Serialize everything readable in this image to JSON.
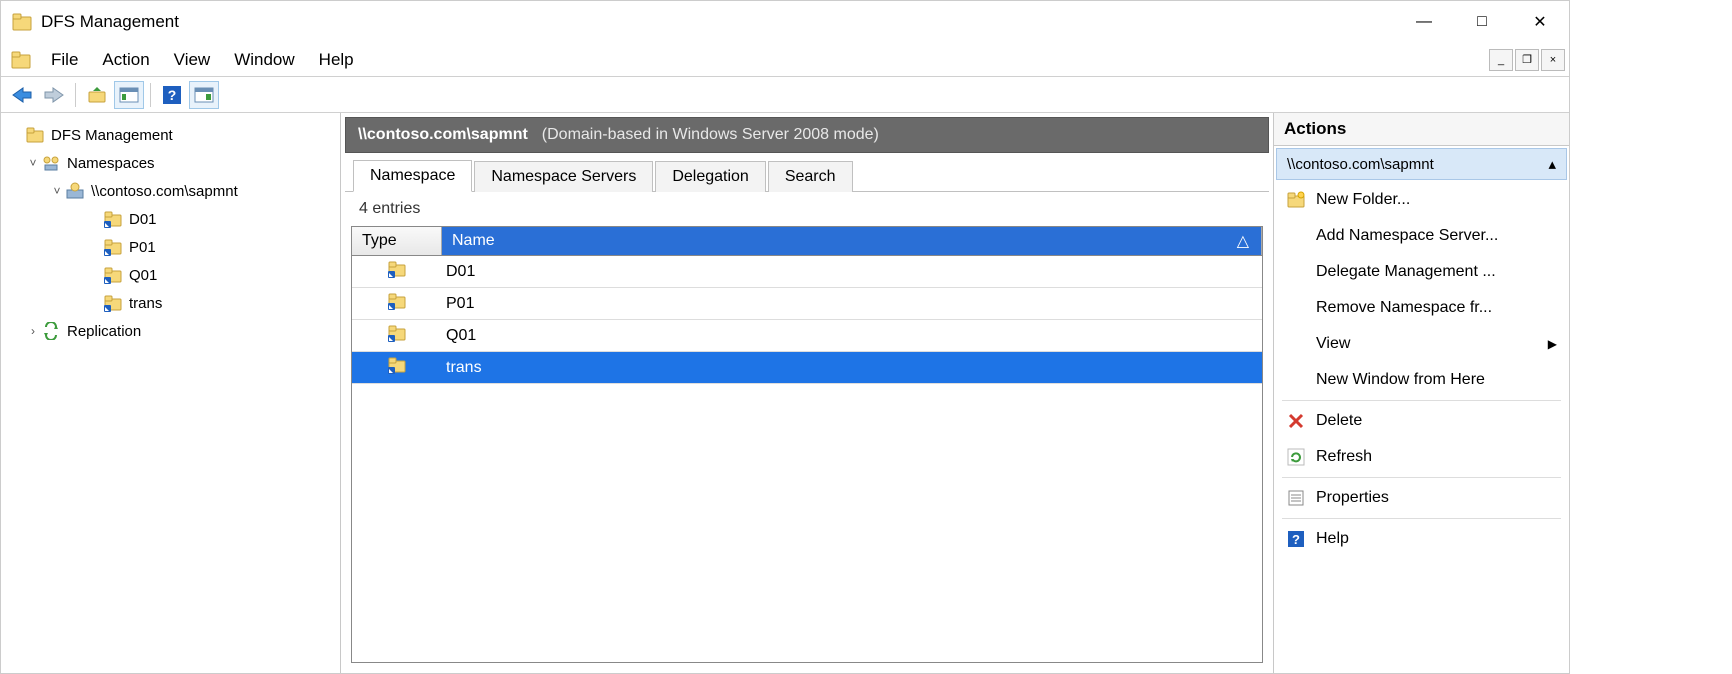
{
  "window": {
    "title": "DFS Management"
  },
  "menubar": {
    "items": [
      "File",
      "Action",
      "View",
      "Window",
      "Help"
    ]
  },
  "tree": {
    "root": "DFS Management",
    "namespaces_label": "Namespaces",
    "namespace_path": "\\\\contoso.com\\sapmnt",
    "folders": [
      "D01",
      "P01",
      "Q01",
      "trans"
    ],
    "replication_label": "Replication"
  },
  "content": {
    "header_title": "\\\\contoso.com\\sapmnt",
    "header_sub": "(Domain-based in Windows Server 2008 mode)",
    "tabs": [
      "Namespace",
      "Namespace Servers",
      "Delegation",
      "Search"
    ],
    "entries_label": "4 entries",
    "columns": {
      "type": "Type",
      "name": "Name"
    },
    "rows": [
      {
        "name": "D01",
        "selected": false
      },
      {
        "name": "P01",
        "selected": false
      },
      {
        "name": "Q01",
        "selected": false
      },
      {
        "name": "trans",
        "selected": true
      }
    ]
  },
  "actions": {
    "title": "Actions",
    "context": "\\\\contoso.com\\sapmnt",
    "items": [
      {
        "label": "New Folder...",
        "icon": "folder-new"
      },
      {
        "label": "Add Namespace Server...",
        "icon": ""
      },
      {
        "label": "Delegate Management ...",
        "icon": ""
      },
      {
        "label": "Remove Namespace fr...",
        "icon": ""
      },
      {
        "label": "View",
        "icon": "",
        "submenu": true
      },
      {
        "label": "New Window from Here",
        "icon": ""
      },
      {
        "label": "Delete",
        "icon": "delete",
        "sep_before": true
      },
      {
        "label": "Refresh",
        "icon": "refresh"
      },
      {
        "label": "Properties",
        "icon": "properties",
        "sep_before": true
      },
      {
        "label": "Help",
        "icon": "help",
        "sep_before": true
      }
    ]
  }
}
